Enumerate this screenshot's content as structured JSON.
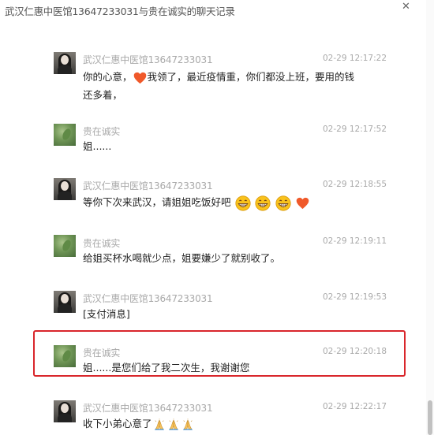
{
  "window": {
    "title": "武汉仁惠中医馆13647233031与贵在诚实的聊天记录",
    "close_icon": "close-icon"
  },
  "messages": [
    {
      "sender": "武汉仁惠中医馆13647233031",
      "time": "02-29 12:17:22",
      "avatar": "woman-photo",
      "line1_a": "你的心意，",
      "line1_emoji": "orange-heart-emoji",
      "line1_b": "我领了，最近疫情重，你们都没上班，要用的钱",
      "line2": "还多着，"
    },
    {
      "sender": "贵在诚实",
      "time": "02-29 12:17:52",
      "avatar": "green-leaf-photo",
      "text": "姐......"
    },
    {
      "sender": "武汉仁惠中医馆13647233031",
      "time": "02-29 12:18:55",
      "avatar": "woman-photo",
      "text": "等你下次来武汉，请姐姐吃饭好吧",
      "emojis": [
        "grin-emoji",
        "grin-emoji",
        "grin-emoji",
        "orange-heart-emoji"
      ]
    },
    {
      "sender": "贵在诚实",
      "time": "02-29 12:19:11",
      "avatar": "green-leaf-photo",
      "text": "给姐买杯水喝就少点，姐要嫌少了就别收了。"
    },
    {
      "sender": "武汉仁惠中医馆13647233031",
      "time": "02-29 12:19:53",
      "avatar": "woman-photo",
      "text": "[支付消息]"
    },
    {
      "sender": "贵在诚实",
      "time": "02-29 12:20:18",
      "avatar": "green-leaf-photo",
      "text": "姐......是您们给了我二次生，我谢谢您",
      "highlighted": true
    },
    {
      "sender": "武汉仁惠中医馆13647233031",
      "time": "02-29 12:22:17",
      "avatar": "woman-photo",
      "text": "收下小弟心意了",
      "emojis": [
        "pray-emoji",
        "pray-emoji",
        "pray-emoji"
      ]
    }
  ],
  "colors": {
    "highlight_border": "#d9262b",
    "meta_text": "#a9a9a9",
    "heart": "#f0592a",
    "grin": "#f9c21c"
  }
}
